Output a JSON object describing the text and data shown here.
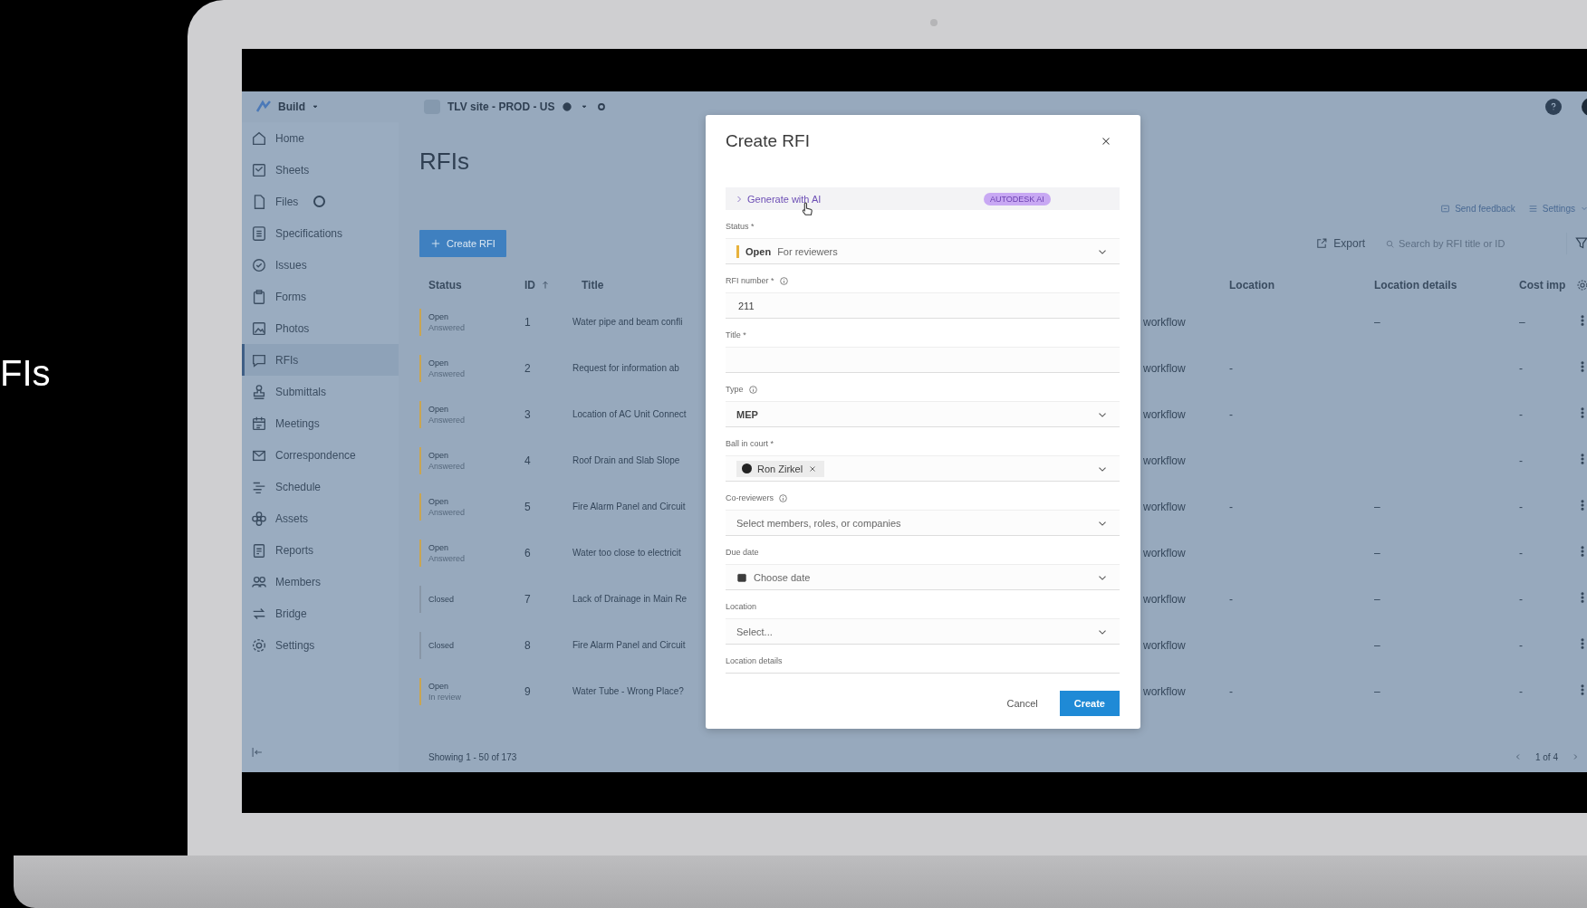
{
  "intro_text": "FIs",
  "topbar": {
    "product": "Build",
    "project": "TLV site - PROD - US"
  },
  "sidebar": {
    "items": [
      {
        "label": "Home",
        "selected": false,
        "indicator": false
      },
      {
        "label": "Sheets",
        "selected": false,
        "indicator": false
      },
      {
        "label": "Files",
        "selected": false,
        "indicator": true
      },
      {
        "label": "Specifications",
        "selected": false,
        "indicator": false
      },
      {
        "label": "Issues",
        "selected": false,
        "indicator": false
      },
      {
        "label": "Forms",
        "selected": false,
        "indicator": false
      },
      {
        "label": "Photos",
        "selected": false,
        "indicator": false
      },
      {
        "label": "RFIs",
        "selected": true,
        "indicator": false
      },
      {
        "label": "Submittals",
        "selected": false,
        "indicator": false
      },
      {
        "label": "Meetings",
        "selected": false,
        "indicator": false
      },
      {
        "label": "Correspondence",
        "selected": false,
        "indicator": false
      },
      {
        "label": "Schedule",
        "selected": false,
        "indicator": false
      },
      {
        "label": "Assets",
        "selected": false,
        "indicator": false
      },
      {
        "label": "Reports",
        "selected": false,
        "indicator": false
      },
      {
        "label": "Members",
        "selected": false,
        "indicator": false
      },
      {
        "label": "Bridge",
        "selected": false,
        "indicator": false
      },
      {
        "label": "Settings",
        "selected": false,
        "indicator": false
      }
    ]
  },
  "page_title": "RFIs",
  "toolbar": {
    "send_feedback": "Send feedback",
    "settings": "Settings",
    "create_button": "Create RFI",
    "export": "Export",
    "search": {
      "placeholder": "Search by RFI title or ID"
    }
  },
  "table": {
    "columns": [
      {
        "label": "Status",
        "sorted": false
      },
      {
        "label": "ID",
        "sorted": true
      },
      {
        "label": "Title",
        "sorted": false
      },
      {
        "label": "Location",
        "sorted": false
      },
      {
        "label": "Location details",
        "sorted": false
      },
      {
        "label": "Cost imp",
        "sorted": false
      }
    ],
    "rows": [
      {
        "status": "Open",
        "substatus": "Answered",
        "color": "#c9a552",
        "id": "1",
        "title": "Water pipe and beam confli",
        "workflow": "workflow",
        "location_details": "–",
        "cost_impact": "–"
      },
      {
        "status": "Open",
        "substatus": "Answered",
        "color": "#c9a552",
        "id": "2",
        "title": "Request for information ab",
        "workflow": "workflow",
        "location": "-",
        "cost_impact": "-"
      },
      {
        "status": "Open",
        "substatus": "Answered",
        "color": "#c9a552",
        "id": "3",
        "title": "Location of AC Unit Connect",
        "workflow": "workflow",
        "location": "-",
        "cost_impact": "-"
      },
      {
        "status": "Open",
        "substatus": "Answered",
        "color": "#c9a552",
        "id": "4",
        "title": "Roof Drain and Slab Slope",
        "workflow": "workflow",
        "cost_impact": "-"
      },
      {
        "status": "Open",
        "substatus": "Answered",
        "color": "#c9a552",
        "id": "5",
        "title": "Fire Alarm Panel and Circuit",
        "workflow": "workflow",
        "location": "-",
        "location_details": "–",
        "cost_impact": "-"
      },
      {
        "status": "Open",
        "substatus": "Answered",
        "color": "#c9a552",
        "id": "6",
        "title": "Water too close to electricit",
        "workflow": "workflow",
        "location_details": "–",
        "cost_impact": "-"
      },
      {
        "status": "Closed",
        "color": "#8896a6",
        "id": "7",
        "title": "Lack of Drainage in Main Re",
        "workflow": "workflow",
        "location": "-",
        "location_details": "–",
        "cost_impact": "-"
      },
      {
        "status": "Closed",
        "color": "#8896a6",
        "id": "8",
        "title": "Fire Alarm Panel and Circuit",
        "workflow": "workflow",
        "location_details": "–",
        "cost_impact": "-"
      },
      {
        "status": "Open",
        "substatus": "In review",
        "color": "#c9a552",
        "id": "9",
        "title": "Water Tube - Wrong Place?",
        "workflow": "workflow",
        "location": "-",
        "location_details": "–",
        "cost_impact": "-"
      }
    ]
  },
  "footer": {
    "showing": "Showing 1 - 50 of 173",
    "page": "1 of 4"
  },
  "modal": {
    "title": "Create RFI",
    "ai_section": {
      "label": "Generate with AI",
      "expanded": false,
      "badge": "AUTODESK AI"
    },
    "fields": [
      {
        "kind": "status",
        "label": "Status *",
        "info": false,
        "value": "Open",
        "detail": "For reviewers",
        "color": "#e8b23c"
      },
      {
        "kind": "text",
        "label": "RFI number *",
        "info": true,
        "value": "211"
      },
      {
        "kind": "text",
        "label": "Title *",
        "info": false
      },
      {
        "kind": "select",
        "label": "Type",
        "info": true,
        "value": "MEP"
      },
      {
        "kind": "people",
        "label": "Ball in court *",
        "info": false,
        "chips": [
          "Ron Zirkel"
        ]
      },
      {
        "kind": "select",
        "label": "Co-reviewers",
        "info": true,
        "placeholder": "Select members, roles, or companies"
      },
      {
        "kind": "date",
        "label": "Due date",
        "info": false,
        "placeholder": "Choose date"
      },
      {
        "kind": "select",
        "label": "Location",
        "info": false,
        "placeholder": "Select..."
      },
      {
        "kind": "label",
        "label": "Location details",
        "info": false
      }
    ],
    "buttons": [
      {
        "kind": "secondary",
        "label": "Cancel"
      },
      {
        "kind": "primary",
        "label": "Create"
      }
    ]
  }
}
